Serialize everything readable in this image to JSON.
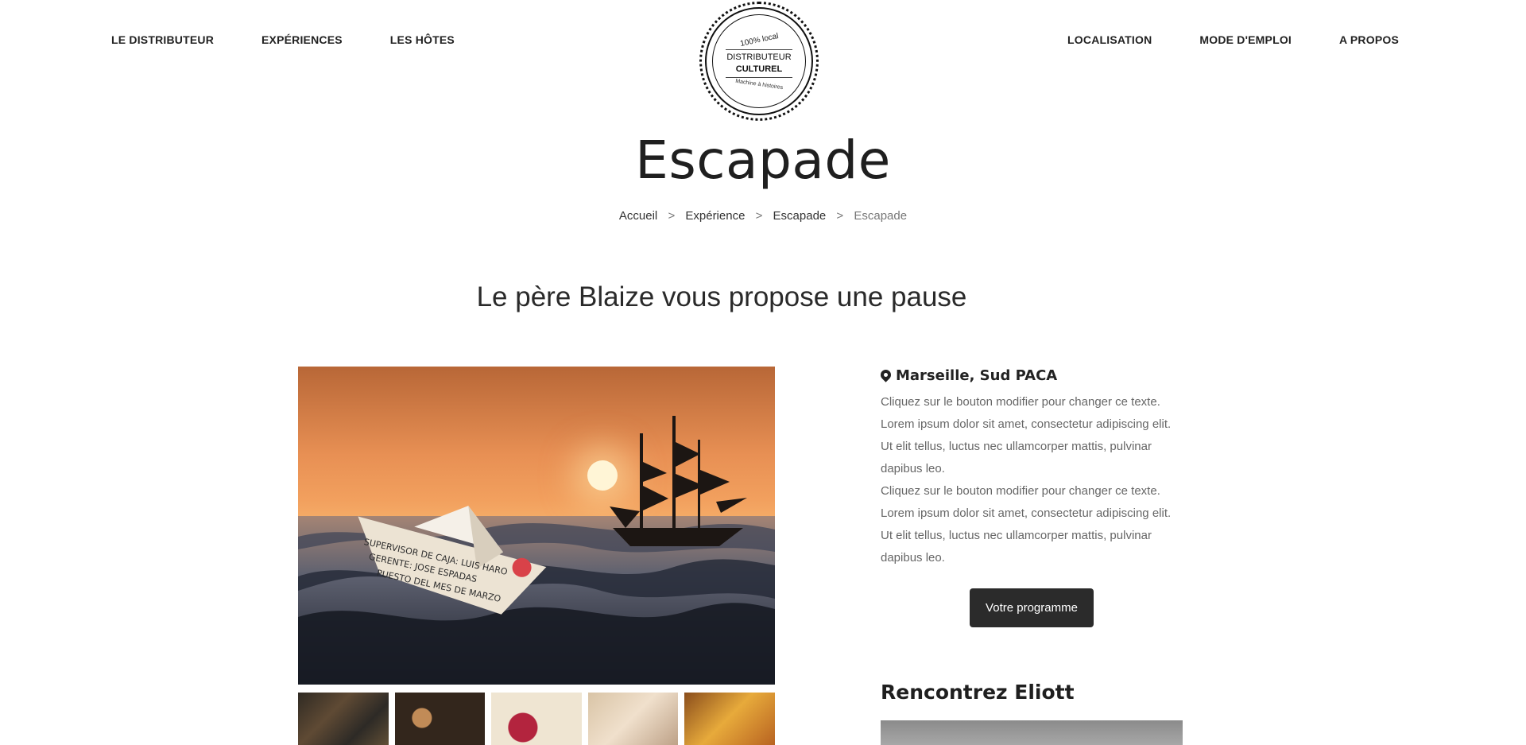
{
  "header": {
    "nav_left": [
      {
        "label": "LE DISTRIBUTEUR"
      },
      {
        "label": "EXPÉRIENCES"
      },
      {
        "label": "LES HÔTES"
      }
    ],
    "nav_right": [
      {
        "label": "LOCALISATION"
      },
      {
        "label": "MODE D'EMPLOI"
      },
      {
        "label": "A PROPOS"
      }
    ],
    "logo": {
      "top_text": "100% local",
      "main_line1": "DISTRIBUTEUR",
      "main_line2": "CULTUREL",
      "bottom_text": "Machine à histoires"
    }
  },
  "page": {
    "title": "Escapade",
    "breadcrumb": [
      {
        "label": "Accueil"
      },
      {
        "label": "Expérience"
      },
      {
        "label": "Escapade"
      },
      {
        "label": "Escapade",
        "current": true
      }
    ],
    "section_heading": "Le père Blaize vous propose une pause"
  },
  "details": {
    "location": "Marseille, Sud PACA",
    "paragraphs": [
      "Cliquez sur le bouton modifier pour changer ce texte.",
      "Lorem ipsum dolor sit amet, consectetur adipiscing elit.",
      "Ut elit tellus, luctus nec ullamcorper mattis, pulvinar",
      "dapibus leo.",
      "Cliquez sur le bouton modifier pour changer ce texte.",
      "Lorem ipsum dolor sit amet, consectetur adipiscing elit.",
      "Ut elit tellus, luctus nec ullamcorper mattis, pulvinar",
      "dapibus leo."
    ],
    "program_button": "Votre programme",
    "meet_heading": "Rencontrez Eliott"
  },
  "main_image": {
    "boat_text_1": "SUPERVISOR DE CAJA: LUIS HARO",
    "boat_text_2": "GERENTE: JOSE ESPADAS",
    "boat_text_3": "PUESTO DEL MES DE MARZO"
  }
}
